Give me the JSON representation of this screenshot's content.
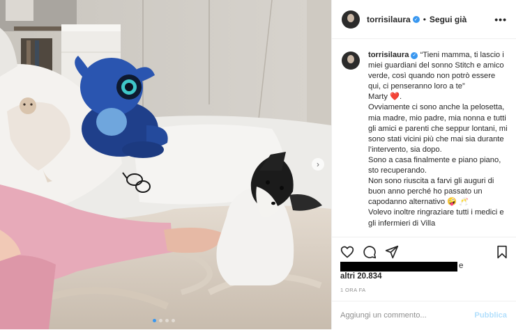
{
  "post": {
    "username": "torrisilaura",
    "verified_glyph": "✓",
    "separator": "•",
    "follow_label": "Segui già",
    "more_glyph": "•••",
    "caption_text": "“Tieni mamma, ti lascio i miei guardiani del sonno Stitch e amico verde, così quando non potrò essere qui, ci penseranno loro a te”\nMarty ❤️.\nOvviamente ci sono anche la pelosetta, mia madre, mio padre, mia nonna e tutti gli amici e parenti che seppur lontani, mi sono stati vicini più che mai sia durante l’intervento, sia dopo.\nSono a casa finalmente e piano piano, sto recuperando.\nNon sono riuscita a farvi gli auguri di buon anno perché ho passato un capodanno alternativo 🤪 🥂\nVolevo inoltre ringraziare tutti i medici e gli infermieri di Villa",
    "likes_suffix": "e",
    "likes_count": "altri 20.834",
    "time_ago": "1 ORA FA",
    "comment_placeholder": "Aggiungi un commento...",
    "publish_label": "Pubblica"
  },
  "carousel": {
    "next_glyph": "›",
    "slide_count": 4,
    "active_index": 0
  },
  "icons": {
    "like": "heart-icon",
    "comment": "comment-icon",
    "share": "share-icon",
    "save": "bookmark-icon"
  },
  "colors": {
    "accent_blue": "#3897f0",
    "publish_disabled": "#b2dffc",
    "muted_text": "#8e8e8e",
    "divider": "#efefef"
  }
}
